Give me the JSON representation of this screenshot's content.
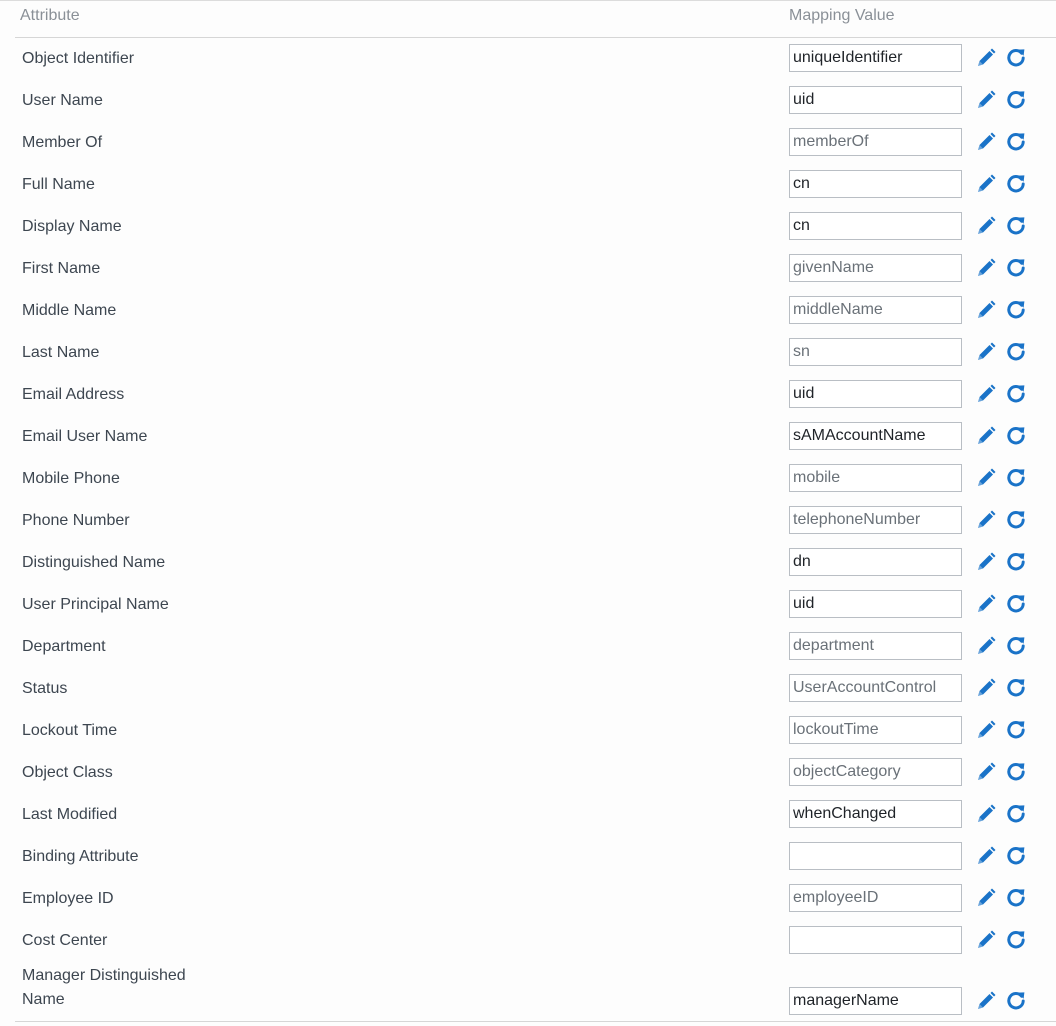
{
  "header": {
    "attribute": "Attribute",
    "mapping_value": "Mapping Value"
  },
  "rows": [
    {
      "label": "Object Identifier",
      "value": "uniqueIdentifier",
      "muted": false
    },
    {
      "label": "User Name",
      "value": "uid",
      "muted": false
    },
    {
      "label": "Member Of",
      "value": "memberOf",
      "muted": true
    },
    {
      "label": "Full Name",
      "value": "cn",
      "muted": false
    },
    {
      "label": "Display Name",
      "value": "cn",
      "muted": false
    },
    {
      "label": "First Name",
      "value": "givenName",
      "muted": true
    },
    {
      "label": "Middle Name",
      "value": "middleName",
      "muted": true
    },
    {
      "label": "Last Name",
      "value": "sn",
      "muted": true
    },
    {
      "label": "Email Address",
      "value": "uid",
      "muted": false
    },
    {
      "label": "Email User Name",
      "value": "sAMAccountName",
      "muted": false
    },
    {
      "label": "Mobile Phone",
      "value": "mobile",
      "muted": true
    },
    {
      "label": "Phone Number",
      "value": "telephoneNumber",
      "muted": true
    },
    {
      "label": "Distinguished Name",
      "value": "dn",
      "muted": false
    },
    {
      "label": "User Principal Name",
      "value": "uid",
      "muted": false
    },
    {
      "label": "Department",
      "value": "department",
      "muted": true
    },
    {
      "label": "Status",
      "value": "UserAccountControl",
      "muted": true
    },
    {
      "label": "Lockout Time",
      "value": "lockoutTime",
      "muted": true
    },
    {
      "label": "Object Class",
      "value": "objectCategory",
      "muted": true
    },
    {
      "label": "Last Modified",
      "value": "whenChanged",
      "muted": false
    },
    {
      "label": "Binding Attribute",
      "value": "",
      "muted": false
    },
    {
      "label": "Employee ID",
      "value": "employeeID",
      "muted": true
    },
    {
      "label": "Cost Center",
      "value": "",
      "muted": false
    },
    {
      "label": "Manager Distinguished Name",
      "value": "managerName",
      "muted": false,
      "tall": true
    }
  ],
  "icons": {
    "edit": "pencil-edit-icon",
    "reset": "reset-refresh-icon"
  },
  "colors": {
    "icon_blue": "#1a73c8",
    "label_text": "#3d4650",
    "header_text": "#8a9097"
  }
}
